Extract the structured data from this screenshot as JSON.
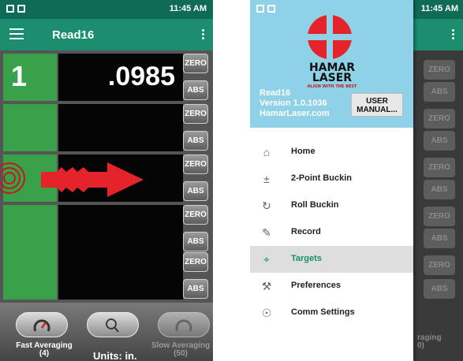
{
  "status": {
    "time": "11:45 AM"
  },
  "app": {
    "title": "Read16"
  },
  "rows": [
    {
      "label": "1",
      "value": ".0985",
      "zero": "ZERO",
      "abs": "ABS"
    },
    {
      "label": "",
      "value": "",
      "zero": "ZERO",
      "abs": "ABS"
    },
    {
      "label": "",
      "value": "",
      "zero": "ZERO",
      "abs": "ABS"
    },
    {
      "label": "",
      "value": "",
      "zero": "ZERO",
      "abs": "ABS"
    },
    {
      "label": "",
      "value": "",
      "zero": "ZERO",
      "abs": "ABS"
    }
  ],
  "bottom": {
    "fast_label": "Fast Averaging",
    "fast_count": "(4)",
    "slow_label": "Slow Averaging",
    "slow_count": "(50)",
    "units": "Units: in."
  },
  "drawer": {
    "brand_line1": "HAMAR",
    "brand_line2": "LASER",
    "brand_tag": "ALIGN WITH THE BEST",
    "app_name": "Read16",
    "version": "Version 1.0.1036",
    "site": "HamarLaser.com",
    "manual_line1": "USER",
    "manual_line2": "MANUAL...",
    "items": [
      {
        "label": "Home",
        "icon": "home-icon"
      },
      {
        "label": "2-Point Buckin",
        "icon": "plus-minus-icon"
      },
      {
        "label": "Roll Buckin",
        "icon": "rotate-icon"
      },
      {
        "label": "Record",
        "icon": "pencil-icon"
      },
      {
        "label": "Targets",
        "icon": "target-icon",
        "selected": true
      },
      {
        "label": "Preferences",
        "icon": "wrench-icon"
      },
      {
        "label": "Comm Settings",
        "icon": "broadcast-icon"
      }
    ]
  },
  "background": {
    "zero": "ZERO",
    "abs": "ABS",
    "averaging_fragment": "raging",
    "count_fragment": "0)"
  },
  "colors": {
    "primary": "#1c8d6f",
    "status_bar": "#0f6b55",
    "green_cell": "#3aa04a",
    "accent_red": "#c21a1a",
    "drawer_header": "#8fd1e6"
  }
}
